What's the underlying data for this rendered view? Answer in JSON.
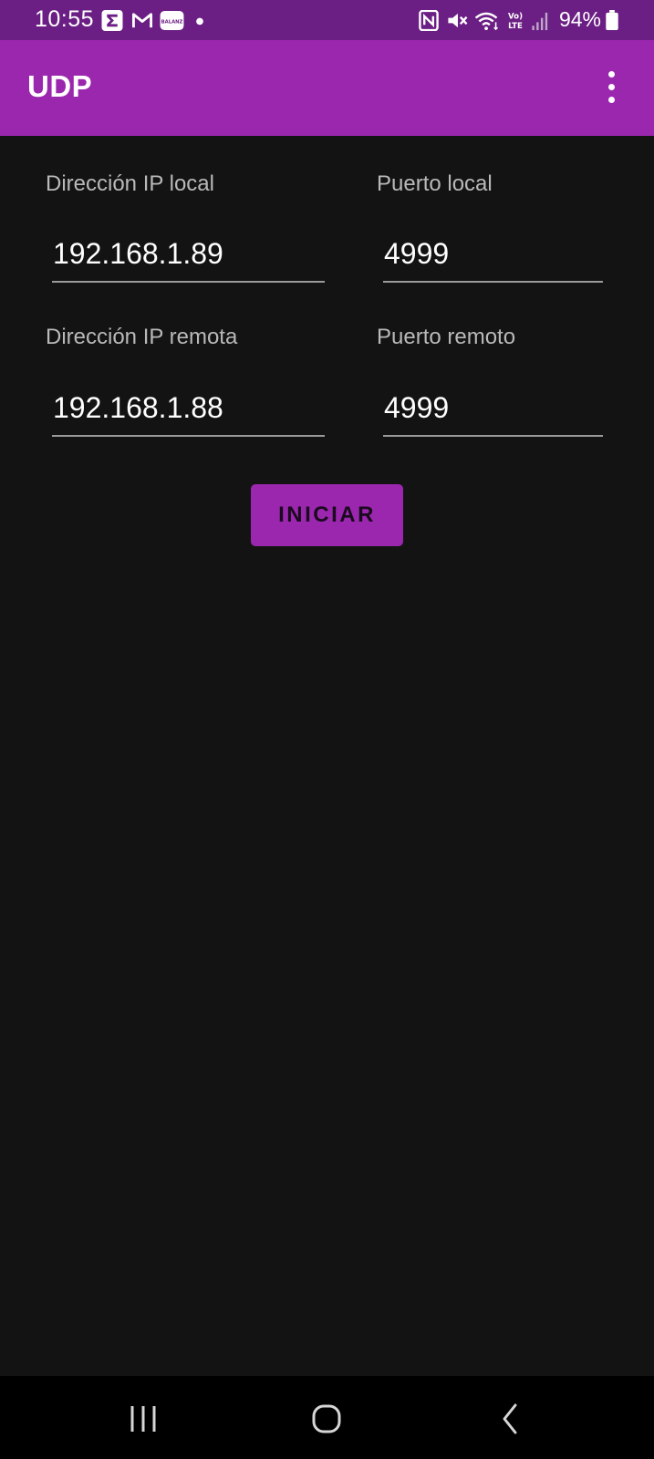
{
  "status_bar": {
    "time": "10:55",
    "battery": "94%",
    "icons": [
      "sigma-notification-icon",
      "gmail-notification-icon",
      "balanz-notification-icon",
      "notification-dot-icon",
      "nfc-icon",
      "mute-icon",
      "wifi-icon",
      "volte-lte-icon",
      "signal-icon",
      "battery-icon"
    ],
    "notification_app_label": "BALANZ",
    "volte_label": "Vo)",
    "lte_label": "LTE"
  },
  "app_bar": {
    "title": "UDP",
    "menu_icon": "overflow-menu-icon"
  },
  "form": {
    "local_ip": {
      "label": "Dirección IP local",
      "value": "192.168.1.89"
    },
    "local_port": {
      "label": "Puerto local",
      "value": "4999"
    },
    "remote_ip": {
      "label": "Dirección IP remota",
      "value": "192.168.1.88"
    },
    "remote_port": {
      "label": "Puerto remoto",
      "value": "4999"
    },
    "start_button": "INICIAR"
  },
  "nav_bar": {
    "icons": [
      "recent-apps-icon",
      "home-icon",
      "back-icon"
    ]
  },
  "colors": {
    "status_bar": "#6b1f84",
    "accent": "#9b27af",
    "background": "#131313",
    "nav_bar": "#000000"
  }
}
